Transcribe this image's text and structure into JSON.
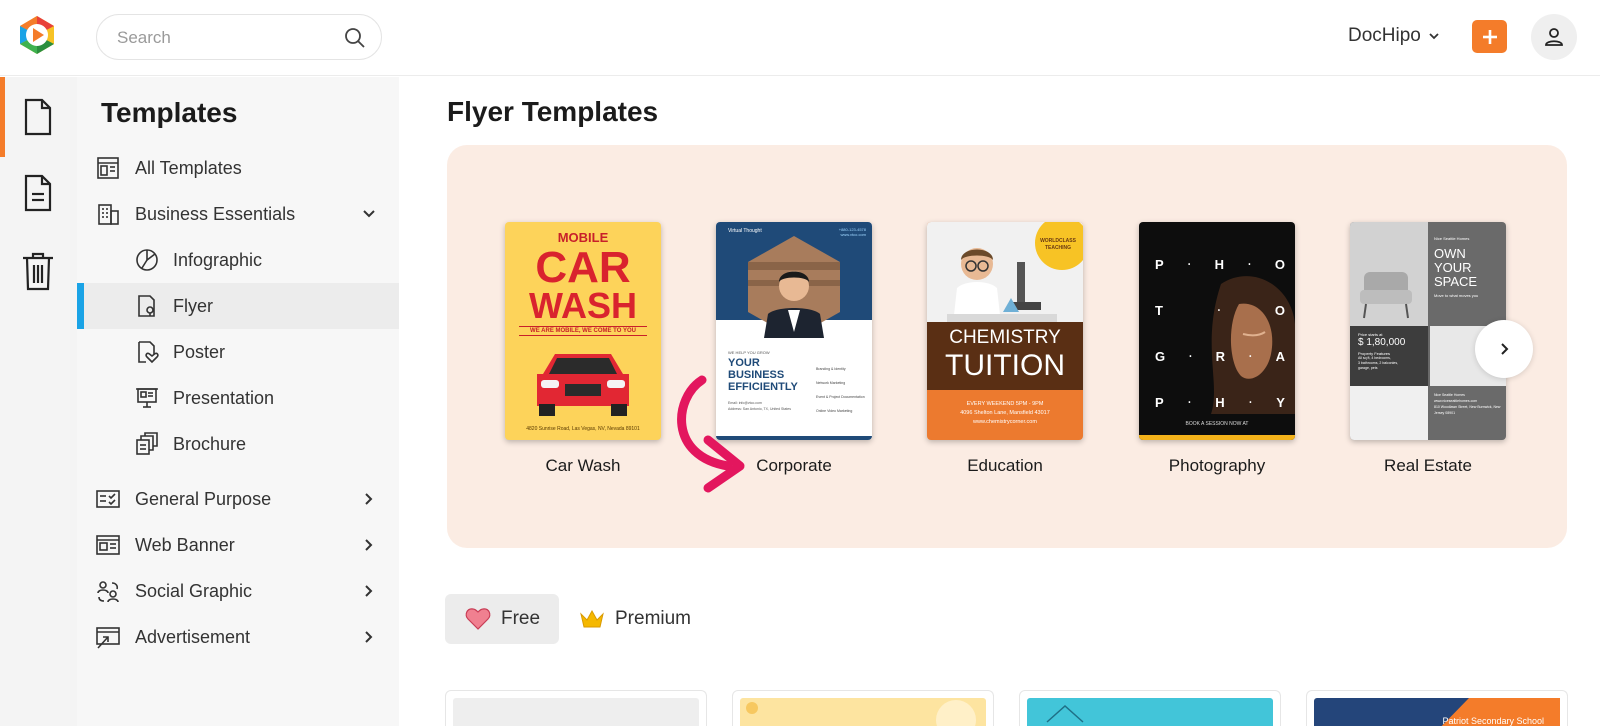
{
  "topbar": {
    "search_placeholder": "Search",
    "account_label": "DocHipo",
    "accent_color": "#f47c2a"
  },
  "rail": {
    "items": [
      {
        "icon": "document-icon",
        "active": true
      },
      {
        "icon": "text-document-icon",
        "active": false
      },
      {
        "icon": "trash-icon",
        "active": false
      }
    ]
  },
  "sidebar": {
    "title": "Templates",
    "items": [
      {
        "label": "All Templates",
        "icon": "layout-icon"
      },
      {
        "label": "Business Essentials",
        "icon": "building-icon",
        "expanded": true
      },
      {
        "label": "Infographic",
        "icon": "pie-chart-icon"
      },
      {
        "label": "Flyer",
        "icon": "flyer-icon",
        "selected": true
      },
      {
        "label": "Poster",
        "icon": "poster-heart-icon"
      },
      {
        "label": "Presentation",
        "icon": "presentation-icon"
      },
      {
        "label": "Brochure",
        "icon": "brochure-icon"
      },
      {
        "label": "General Purpose",
        "icon": "checklist-icon"
      },
      {
        "label": "Web Banner",
        "icon": "web-banner-icon"
      },
      {
        "label": "Social Graphic",
        "icon": "social-icon"
      },
      {
        "label": "Advertisement",
        "icon": "advertisement-icon"
      }
    ],
    "selected_color": "#1aa3e6"
  },
  "main": {
    "title": "Flyer Templates",
    "carousel": {
      "cards": [
        {
          "caption": "Car Wash",
          "thumb": {
            "top": "MOBILE",
            "big1": "CAR",
            "big2": "WASH",
            "sub": "WE ARE MOBILE, WE COME TO YOU",
            "foot": "4820 Sunrise Road, Las Vegas, NV, Nevada 89101"
          }
        },
        {
          "caption": "Corporate",
          "thumb": {
            "brand": "Virtual Thought",
            "site": "www.vtco.com",
            "phone": "+880-123-4578",
            "small": "WE HELP YOU GROW",
            "l1": "YOUR",
            "l2": "BUSINESS",
            "l3": "EFFICIENTLY",
            "svc1": "Branding & Identity",
            "svc2": "Network Marketing",
            "svc3": "Event & Project Documentation",
            "svc4": "Online Video Marketing",
            "email": "Email: info@vtco.com",
            "address": "Address: San Antonio, TX, United States"
          }
        },
        {
          "caption": "Education",
          "thumb": {
            "badge1": "WORLDCLASS",
            "badge2": "TEACHING",
            "big1": "CHEMISTRY",
            "big2": "TUITION",
            "sub": "EVERY WEEKEND 5PM - 9PM",
            "addr": "4096 Shelton Lane, Mansfield 43017",
            "site": "www.chemistrycorner.com"
          }
        },
        {
          "caption": "Photography",
          "thumb": {
            "rows": [
              "P · H · O",
              "T · O",
              "G · R · A",
              "P · H · Y"
            ],
            "foot": "BOOK A SESSION NOW AT"
          }
        },
        {
          "caption": "Real Estate",
          "thumb": {
            "brand": "Nice Seattle Homes",
            "h1": "OWN",
            "h2": "YOUR",
            "h3": "SPACE",
            "tag": "Move to what moves you",
            "price_label": "Price starts at",
            "price": "$ 1,80,000",
            "features": "Property Features",
            "f1": "All sq ft, 4 bedrooms,",
            "f2": "3 bathrooms, 2 balconies,",
            "f3": "garage, pets",
            "brand2": "Nice Seattle Homes",
            "site": "www.niceseattlehomes.com",
            "addr": "810 Woodlawn Street, New Burnwick, New Jersey 08901"
          }
        }
      ]
    },
    "filters": {
      "free_label": "Free",
      "premium_label": "Premium"
    },
    "tiles": [
      {
        "color": "#eeeeee",
        "text": ""
      },
      {
        "color": "#fde4a0",
        "text": ""
      },
      {
        "color": "#42c5d9",
        "text": ""
      },
      {
        "color": "#24457a",
        "text": "Patriot Secondary School"
      }
    ]
  }
}
